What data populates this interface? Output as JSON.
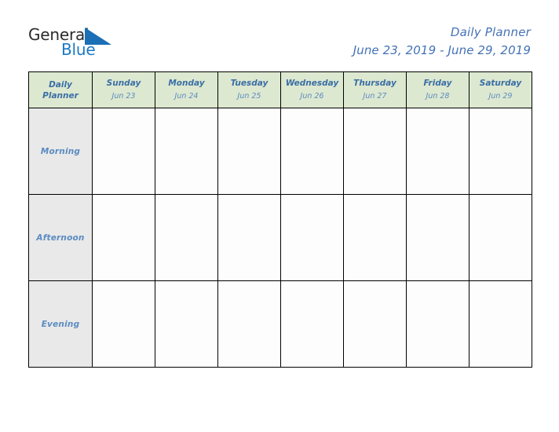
{
  "brand": {
    "name_part1": "General",
    "name_part2": "Blue",
    "triangle_icon": "blue-triangle-icon",
    "colors": {
      "text_dark": "#2b2b2b",
      "blue": "#1a7ac4"
    }
  },
  "header": {
    "title": "Daily Planner",
    "date_range": "June 23, 2019 - June 29, 2019"
  },
  "planner": {
    "corner_label_line1": "Daily",
    "corner_label_line2": "Planner",
    "colors": {
      "header_background": "#ddE8d0",
      "row_label_background": "#e9e9e9",
      "cell_background": "#fdfdfd",
      "accent_blue": "#3a6ea5",
      "muted_blue": "#5b8bc0",
      "border": "#000000"
    },
    "days": [
      {
        "name": "Sunday",
        "date": "Jun 23"
      },
      {
        "name": "Monday",
        "date": "Jun 24"
      },
      {
        "name": "Tuesday",
        "date": "Jun 25"
      },
      {
        "name": "Wednesday",
        "date": "Jun 26"
      },
      {
        "name": "Thursday",
        "date": "Jun 27"
      },
      {
        "name": "Friday",
        "date": "Jun 28"
      },
      {
        "name": "Saturday",
        "date": "Jun 29"
      }
    ],
    "time_slots": [
      {
        "label": "Morning",
        "entries": [
          "",
          "",
          "",
          "",
          "",
          "",
          ""
        ]
      },
      {
        "label": "Afternoon",
        "entries": [
          "",
          "",
          "",
          "",
          "",
          "",
          ""
        ]
      },
      {
        "label": "Evening",
        "entries": [
          "",
          "",
          "",
          "",
          "",
          "",
          ""
        ]
      }
    ]
  }
}
